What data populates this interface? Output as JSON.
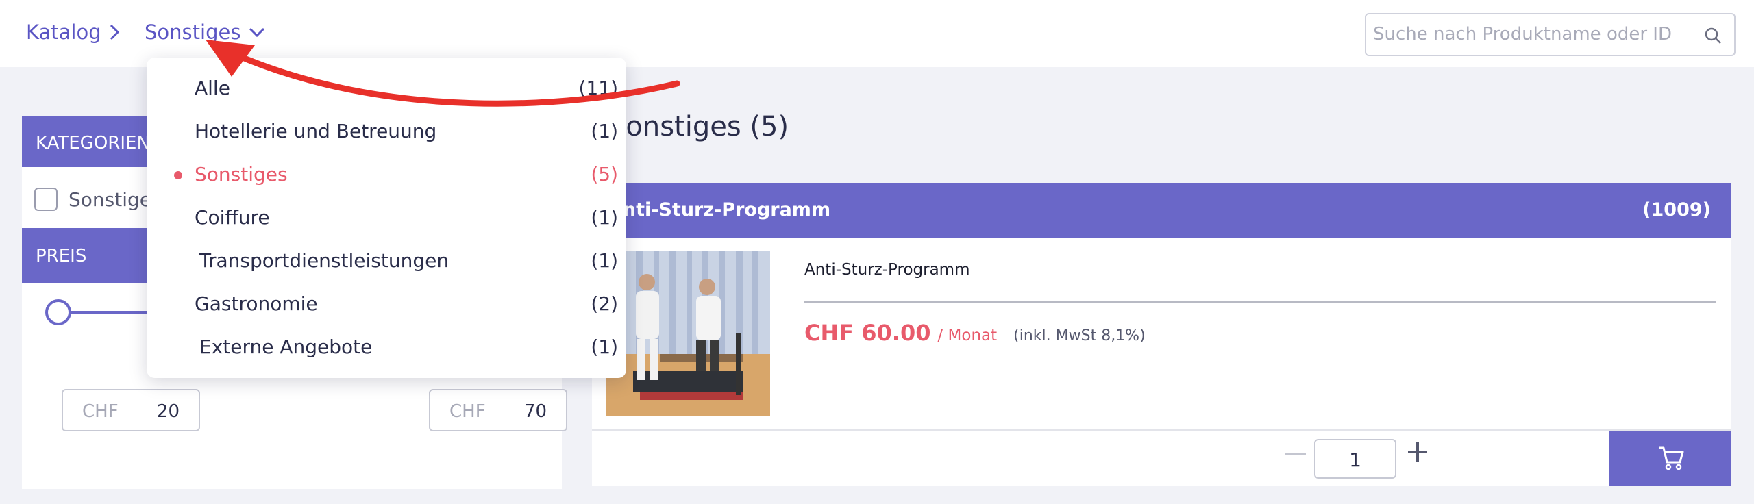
{
  "breadcrumb": {
    "root_label": "Katalog",
    "current_label": "Sonstiges"
  },
  "search": {
    "placeholder": "Suche nach Produktname oder ID"
  },
  "sidebar": {
    "categories_title": "KATEGORIEN",
    "category_checkbox_label": "Sonstiges",
    "price_title": "PREIS",
    "price_min": {
      "currency": "CHF",
      "value": "20"
    },
    "price_max": {
      "currency": "CHF",
      "value": "70"
    }
  },
  "dropdown": {
    "items": [
      {
        "label": "Alle",
        "count": "(11)",
        "active": false
      },
      {
        "label": "Hotellerie und Betreuung",
        "count": "(1)",
        "active": false
      },
      {
        "label": "Sonstiges",
        "count": "(5)",
        "active": true
      },
      {
        "label": "Coiffure",
        "count": "(1)",
        "active": false
      },
      {
        "label": "Transportdienstleistungen",
        "count": "(1)",
        "active": false
      },
      {
        "label": "Gastronomie",
        "count": "(2)",
        "active": false
      },
      {
        "label": "Externe Angebote",
        "count": "(1)",
        "active": false
      }
    ]
  },
  "main": {
    "title": "Sonstiges (5)",
    "card": {
      "header_name": "Anti-Sturz-Programm",
      "header_code": "(1009)",
      "product_name": "Anti-Sturz-Programm",
      "price": "CHF 60.00",
      "price_unit": "/ Monat",
      "vat_note": "(inkl. MwSt 8,1%)",
      "quantity": "1"
    }
  },
  "colors": {
    "accent": "#6a67c8",
    "price": "#e85a6b",
    "annotation": "#e8302a"
  },
  "icons": [
    "chevron-right-icon",
    "chevron-down-icon",
    "search-icon",
    "minus-icon",
    "plus-icon",
    "cart-icon"
  ]
}
